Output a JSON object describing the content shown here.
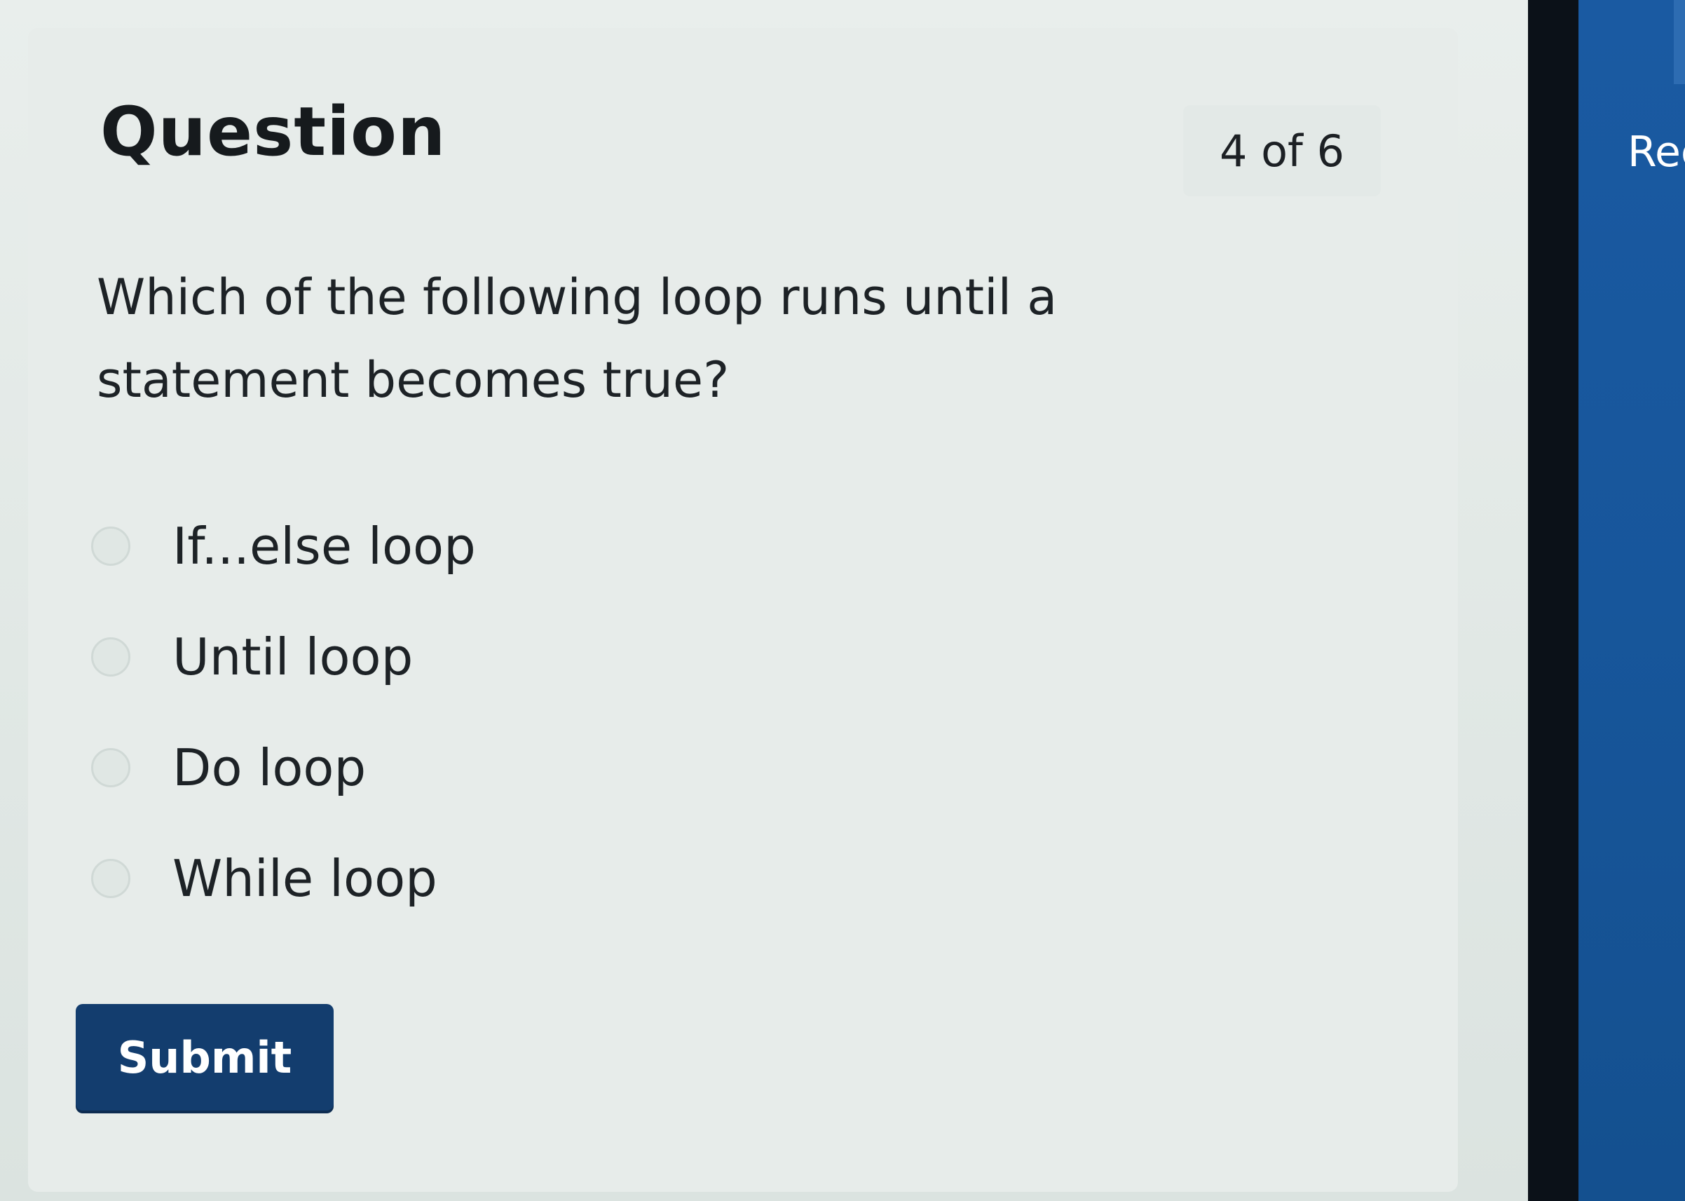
{
  "quiz": {
    "heading": "Question",
    "counter": "4 of 6",
    "question_text": "Which of the following loop runs until a statement becomes true?",
    "options": [
      {
        "label": "If...else loop",
        "selected": false
      },
      {
        "label": "Until loop",
        "selected": false
      },
      {
        "label": "Do loop",
        "selected": false
      },
      {
        "label": "While loop",
        "selected": false
      }
    ],
    "submit_label": "Submit"
  },
  "side_panel": {
    "label": "Rec"
  },
  "colors": {
    "submit_button": "#133d6e",
    "side_panel": "#1a5aa2",
    "card_background": "#e7ecea"
  }
}
